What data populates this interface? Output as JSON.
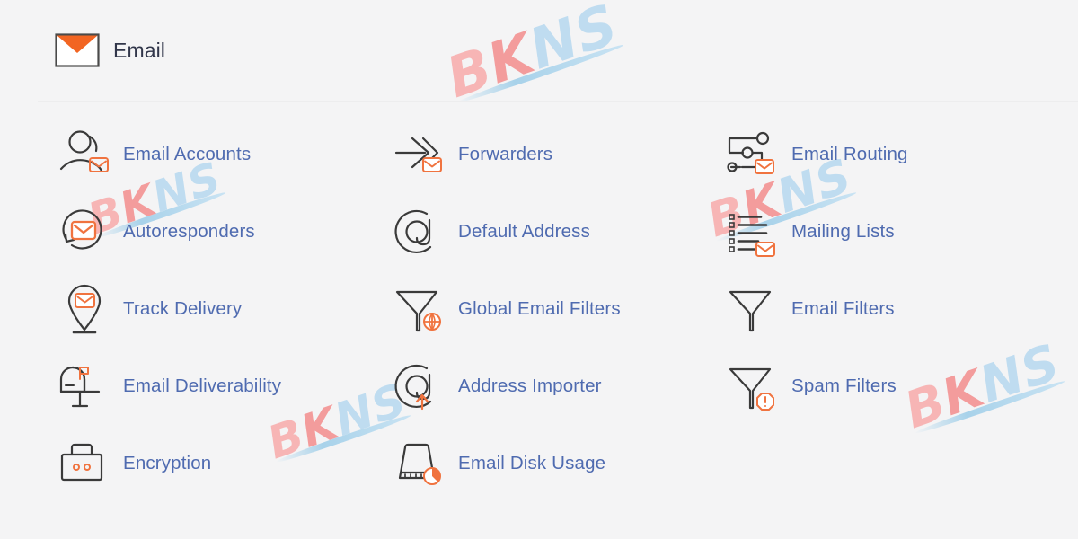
{
  "page": {
    "background_color": "#f4f4f5",
    "panel_color": "#ffffff",
    "accent_color": "#f0733f",
    "link_color": "#4f6bb0",
    "title_color": "#31364a",
    "divider_color": "#ededee"
  },
  "header": {
    "icon": "envelope-icon",
    "title": "Email"
  },
  "items": [
    {
      "label": "Email Accounts",
      "icon": "user-envelope-icon",
      "column": 1,
      "row": 1
    },
    {
      "label": "Forwarders",
      "icon": "arrow-forward-envelope-icon",
      "column": 2,
      "row": 1
    },
    {
      "label": "Email Routing",
      "icon": "routing-nodes-envelope-icon",
      "column": 3,
      "row": 1
    },
    {
      "label": "Autoresponders",
      "icon": "refresh-loop-envelope-icon",
      "column": 1,
      "row": 2
    },
    {
      "label": "Default Address",
      "icon": "at-sign-icon",
      "column": 2,
      "row": 2
    },
    {
      "label": "Mailing Lists",
      "icon": "list-envelope-icon",
      "column": 3,
      "row": 2
    },
    {
      "label": "Track Delivery",
      "icon": "map-pin-envelope-icon",
      "column": 1,
      "row": 3
    },
    {
      "label": "Global Email Filters",
      "icon": "funnel-globe-icon",
      "column": 2,
      "row": 3
    },
    {
      "label": "Email Filters",
      "icon": "funnel-icon",
      "column": 3,
      "row": 3
    },
    {
      "label": "Email Deliverability",
      "icon": "mailbox-flag-icon",
      "column": 1,
      "row": 4
    },
    {
      "label": "Address Importer",
      "icon": "at-sign-upload-icon",
      "column": 2,
      "row": 4
    },
    {
      "label": "Spam Filters",
      "icon": "funnel-warning-icon",
      "column": 3,
      "row": 4
    },
    {
      "label": "Encryption",
      "icon": "padlock-icon",
      "column": 1,
      "row": 5
    },
    {
      "label": "Email Disk Usage",
      "icon": "disk-pie-icon",
      "column": 2,
      "row": 5
    }
  ],
  "watermark": {
    "text": "BKNS",
    "letters": [
      "B",
      "K",
      "N",
      "S"
    ],
    "colors": {
      "b": "#f7b5b5",
      "k": "#f39c9c",
      "n": "#bfdcf0",
      "s": "#bfdcf0"
    }
  }
}
